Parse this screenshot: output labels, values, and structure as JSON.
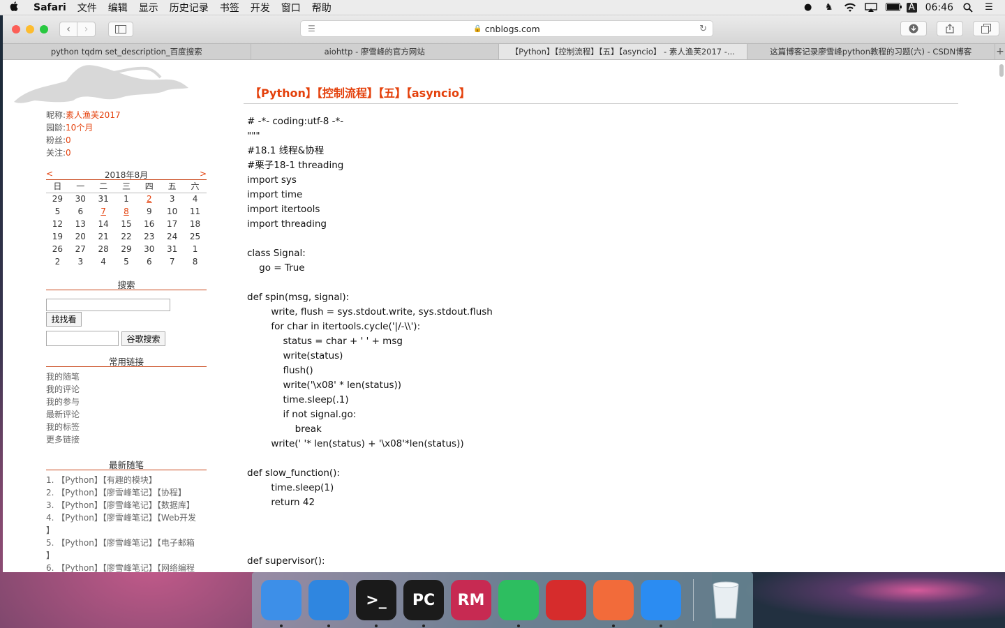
{
  "menubar": {
    "app_name": "Safari",
    "items": [
      "文件",
      "编辑",
      "显示",
      "历史记录",
      "书签",
      "开发",
      "窗口",
      "帮助"
    ],
    "input_indicator": "A",
    "clock": "06:46"
  },
  "toolbar": {
    "address": "cnblogs.com"
  },
  "tabs": [
    {
      "label": "python tqdm set_description_百度搜索",
      "active": false
    },
    {
      "label": "aiohttp - 廖雪峰的官方网站",
      "active": false
    },
    {
      "label": "【Python】【控制流程】【五】【asyncio】 - 素人渔芙2017 -...",
      "active": true
    },
    {
      "label": "这篇博客记录廖雪峰python教程的习题(六) - CSDN博客",
      "active": false
    }
  ],
  "profile": {
    "nickname_label": "昵称:",
    "nickname": "素人渔芙2017",
    "age_label": "园龄:",
    "age": "10个月",
    "fans_label": "粉丝:",
    "fans": "0",
    "follow_label": "关注:",
    "follow": "0"
  },
  "calendar": {
    "prev": "<",
    "next": ">",
    "month": "2018年8月",
    "weekdays": [
      "日",
      "一",
      "二",
      "三",
      "四",
      "五",
      "六"
    ],
    "weeks": [
      [
        "29",
        "30",
        "31",
        "1",
        "2",
        "3",
        "4"
      ],
      [
        "5",
        "6",
        "7",
        "8",
        "9",
        "10",
        "11"
      ],
      [
        "12",
        "13",
        "14",
        "15",
        "16",
        "17",
        "18"
      ],
      [
        "19",
        "20",
        "21",
        "22",
        "23",
        "24",
        "25"
      ],
      [
        "26",
        "27",
        "28",
        "29",
        "30",
        "31",
        "1"
      ],
      [
        "2",
        "3",
        "4",
        "5",
        "6",
        "7",
        "8"
      ]
    ],
    "linked_days": [
      "2",
      "7",
      "8"
    ]
  },
  "search": {
    "title": "搜索",
    "button": "找找看",
    "google_button": "谷歌搜索"
  },
  "links": {
    "title": "常用链接",
    "items": [
      "我的随笔",
      "我的评论",
      "我的参与",
      "最新评论",
      "我的标签",
      "更多链接"
    ]
  },
  "recent": {
    "title": "最新随笔",
    "items": [
      "1. 【Python】【有趣的模块】",
      "2. 【Python】【廖雪峰笔记】【协程】",
      "3. 【Python】【廖雪峰笔记】【数据库】",
      "4. 【Python】【廖雪峰笔记】【Web开发",
      "】",
      "5. 【Python】【廖雪峰笔记】【电子邮箱",
      "】",
      "6. 【Python】【廖雪峰笔记】【网络编程"
    ]
  },
  "post": {
    "title": "【Python】【控制流程】【五】【asyncio】",
    "code": "# -*- coding:utf-8 -*-\n\"\"\"\n#18.1 线程&协程\n#栗子18-1 threading\nimport sys\nimport time\nimport itertools\nimport threading\n\nclass Signal:\n    go = True\n\ndef spin(msg, signal):\n        write, flush = sys.stdout.write, sys.stdout.flush\n        for char in itertools.cycle('|/-\\\\'):\n            status = char + ' ' + msg\n            write(status)\n            flush()\n            write('\\x08' * len(status))\n            time.sleep(.1)\n            if not signal.go:\n                break\n        write(' '* len(status) + '\\x08'*len(status))\n\ndef slow_function():\n        time.sleep(1)\n        return 42\n\n\n\ndef supervisor():"
  },
  "dock": {
    "apps": [
      {
        "name": "Finder",
        "label": "",
        "color": "#3d8fe8",
        "running": true
      },
      {
        "name": "Safari",
        "label": "",
        "color": "#2f86e0",
        "running": true
      },
      {
        "name": "Terminal",
        "label": ">_",
        "color": "#1a1a1a",
        "running": true
      },
      {
        "name": "PyCharm",
        "label": "PC",
        "color": "#1b1b1b",
        "running": true
      },
      {
        "name": "RubyMine",
        "label": "RM",
        "color": "#c72a52",
        "running": false
      },
      {
        "name": "Evernote",
        "label": "",
        "color": "#2dbe60",
        "running": true
      },
      {
        "name": "Bear",
        "label": "",
        "color": "#d62c2c",
        "running": false
      },
      {
        "name": "Postman",
        "label": "",
        "color": "#f26b3a",
        "running": true
      },
      {
        "name": "DingTalk",
        "label": "",
        "color": "#2b8cf2",
        "running": true
      }
    ]
  }
}
